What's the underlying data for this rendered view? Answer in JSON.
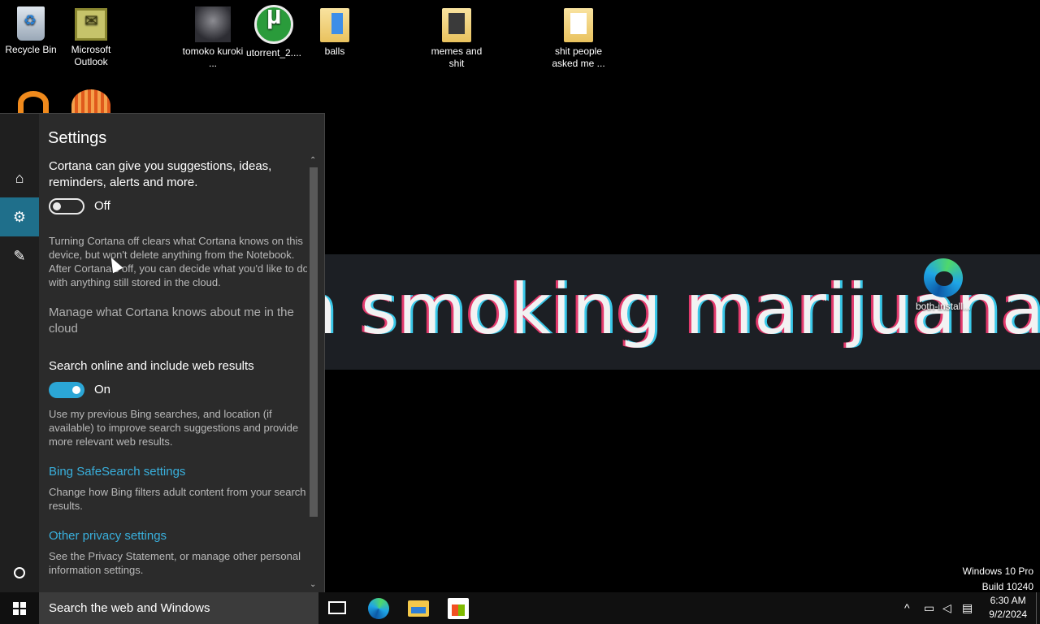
{
  "desktop": {
    "icons": [
      {
        "label": "Recycle Bin"
      },
      {
        "label": "Microsoft Outlook"
      },
      {
        "label": "tomoko kuroki ..."
      },
      {
        "label": "utorrent_2...."
      },
      {
        "label": "balls"
      },
      {
        "label": "memes and shit"
      },
      {
        "label": "shit people asked me ..."
      },
      {
        "label": "both-install..."
      }
    ],
    "wallpaper_text": "n smoking marijuana",
    "watermark": {
      "edition": "Windows 10 Pro",
      "build": "Build 10240"
    }
  },
  "cortana": {
    "title": "Settings",
    "suggestions_text": "Cortana can give you suggestions, ideas, reminders, alerts and more.",
    "cortana_toggle": {
      "state": "Off"
    },
    "off_description": "Turning Cortana off clears what Cortana knows on this device, but won't delete anything from the Notebook. After Cortana's off, you can decide what you'd like to do with anything still stored in the cloud.",
    "manage_text": "Manage what Cortana knows about me in the cloud",
    "web_heading": "Search online and include web results",
    "web_toggle": {
      "state": "On"
    },
    "web_description": "Use my previous Bing searches, and location (if available) to improve search suggestions and provide more relevant web results.",
    "safesearch_link": "Bing SafeSearch settings",
    "safesearch_description": "Change how Bing filters adult content from your search results.",
    "privacy_link": "Other privacy settings",
    "privacy_description": "See the Privacy Statement, or manage other personal information settings."
  },
  "taskbar": {
    "search_placeholder": "Search the web and Windows",
    "time": "6:30 AM",
    "date": "9/2/2024"
  },
  "colors": {
    "accent": "#2ba6d6",
    "link": "#39b0dd",
    "panel_bg": "#2b2b2b",
    "rail_active": "#1f6f8b"
  }
}
